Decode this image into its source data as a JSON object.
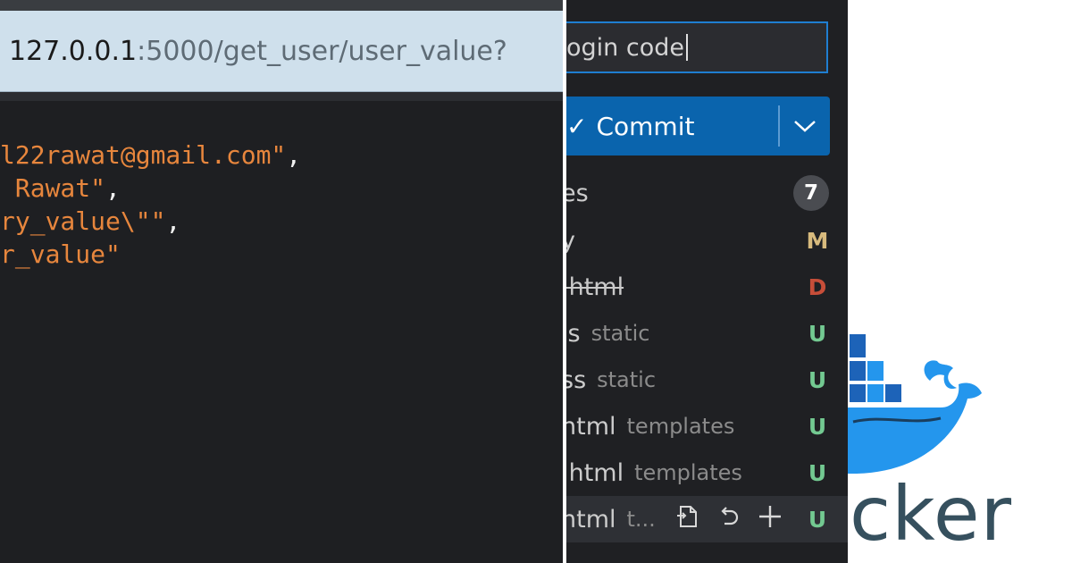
{
  "browser": {
    "url_host": "127.0.0.1",
    "url_path": ":5000/get_user/user_value?",
    "json_lines": [
      {
        "str": "l22rawat@gmail.com\"",
        "punct": ","
      },
      {
        "str": " Rawat\"",
        "punct": ","
      },
      {
        "str": "ry_value\\\"\"",
        "punct": ","
      },
      {
        "str": "r_value\"",
        "punct": ""
      }
    ]
  },
  "scm": {
    "commit_message": "ogin code",
    "commit_button_label": "Commit",
    "changes_label": "es",
    "changes_count": "7",
    "files": [
      {
        "name": "y",
        "dir": "",
        "status": "M"
      },
      {
        "name": ".html",
        "dir": "",
        "status": "D"
      },
      {
        "name": "js",
        "dir": "static",
        "status": "U"
      },
      {
        "name": "ss",
        "dir": "static",
        "status": "U"
      },
      {
        "name": "html",
        "dir": "templates",
        "status": "U"
      },
      {
        "name": ".html",
        "dir": "templates",
        "status": "U"
      },
      {
        "name": "html",
        "dir": "t...",
        "status": "U"
      }
    ],
    "icons": [
      "open-file-icon",
      "discard-changes-icon",
      "stage-changes-icon"
    ]
  },
  "docker": {
    "wordmark": "cker",
    "colors": {
      "whale": "#2496ed",
      "text": "#36505e"
    }
  }
}
